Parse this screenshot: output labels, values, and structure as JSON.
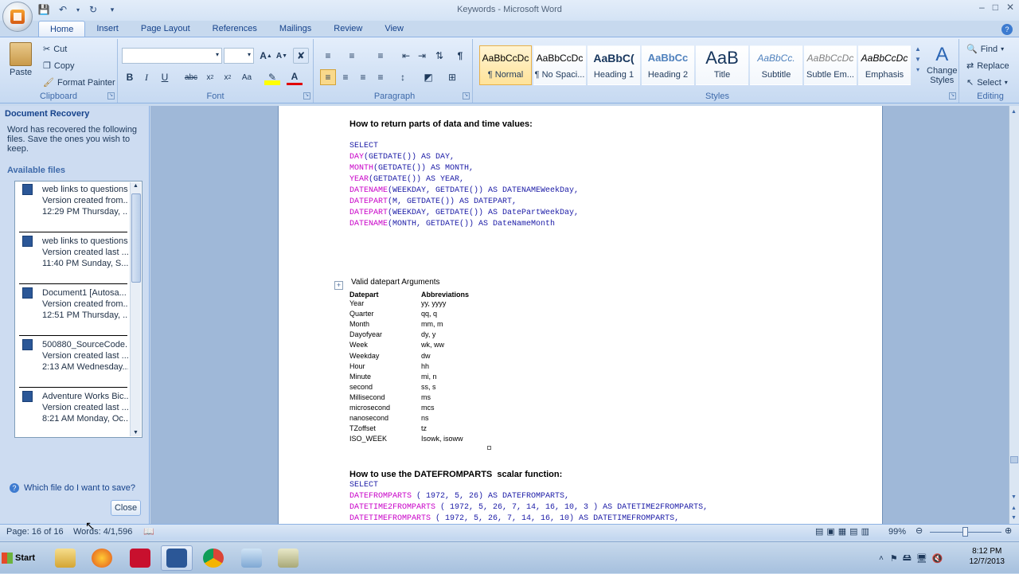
{
  "window": {
    "title": "Keywords - Microsoft Word"
  },
  "tabs": [
    "Home",
    "Insert",
    "Page Layout",
    "References",
    "Mailings",
    "Review",
    "View"
  ],
  "clipboard": {
    "paste": "Paste",
    "cut": "Cut",
    "copy": "Copy",
    "format_painter": "Format Painter",
    "label": "Clipboard"
  },
  "font": {
    "label": "Font"
  },
  "paragraph": {
    "label": "Paragraph"
  },
  "styles": {
    "label": "Styles",
    "items": [
      {
        "preview": "AaBbCcDc",
        "name": "¶ Normal"
      },
      {
        "preview": "AaBbCcDc",
        "name": "¶ No Spaci..."
      },
      {
        "preview": "AaBbC(",
        "name": "Heading 1"
      },
      {
        "preview": "AaBbCc",
        "name": "Heading 2"
      },
      {
        "preview": "AaB",
        "name": "Title"
      },
      {
        "preview": "AaBbCc.",
        "name": "Subtitle"
      },
      {
        "preview": "AaBbCcDc",
        "name": "Subtle Em..."
      },
      {
        "preview": "AaBbCcDc",
        "name": "Emphasis"
      }
    ],
    "change_styles_1": "Change",
    "change_styles_2": "Styles"
  },
  "editing": {
    "find": "Find",
    "replace": "Replace",
    "select": "Select",
    "label": "Editing"
  },
  "recovery": {
    "header": "Document Recovery",
    "message": "Word has recovered the following files.  Save the ones you wish to keep.",
    "available": "Available files",
    "files": [
      {
        "name": "web links to questions ...",
        "desc": "Version created from...",
        "time": "12:29 PM Thursday, ..."
      },
      {
        "name": "web links to questions ...",
        "desc": "Version created last ...",
        "time": "11:40 PM Sunday, S..."
      },
      {
        "name": "Document1  [Autosa...",
        "desc": "Version created from...",
        "time": "12:51 PM Thursday, ..."
      },
      {
        "name": "500880_SourceCode...",
        "desc": "Version created last ...",
        "time": "2:13 AM Wednesday..."
      },
      {
        "name": "Adventure Works Bic...",
        "desc": "Version created last ...",
        "time": "8:21 AM Monday, Oc..."
      }
    ],
    "which_file": "Which file do I want to save?",
    "close": "Close"
  },
  "document": {
    "heading1": "How to return parts of data and time values:",
    "code1": [
      {
        "fn": "",
        "rest": "SELECT"
      },
      {
        "fn": "DAY",
        "rest": "(GETDATE()) AS DAY,"
      },
      {
        "fn": "MONTH",
        "rest": "(GETDATE()) AS MONTH,"
      },
      {
        "fn": "YEAR",
        "rest": "(GETDATE()) AS YEAR,"
      },
      {
        "fn": "DATENAME",
        "rest": "(WEEKDAY, GETDATE()) AS DATENAMEWeekDay,"
      },
      {
        "fn": "DATEPART",
        "rest": "(M, GETDATE()) AS DATEPART,"
      },
      {
        "fn": "DATEPART",
        "rest": "(WEEKDAY, GETDATE()) AS DatePartWeekDay,"
      },
      {
        "fn": "DATENAME",
        "rest": "(MONTH, GETDATE()) AS DateNameMonth"
      }
    ],
    "table_title": "Valid datepart Arguments",
    "table_headers": [
      "Datepart",
      "Abbreviations"
    ],
    "table_rows": [
      [
        "Year",
        "yy, yyyy"
      ],
      [
        "Quarter",
        "qq, q"
      ],
      [
        "Month",
        "mm, m"
      ],
      [
        "Dayofyear",
        "dy, y"
      ],
      [
        "Week",
        "wk, ww"
      ],
      [
        "Weekday",
        "dw"
      ],
      [
        "Hour",
        "hh"
      ],
      [
        "Minute",
        "mi, n"
      ],
      [
        "second",
        "ss, s"
      ],
      [
        "Millisecond",
        "ms"
      ],
      [
        "microsecond",
        "mcs"
      ],
      [
        "nanosecond",
        "ns"
      ],
      [
        "TZoffset",
        "tz"
      ],
      [
        "ISO_WEEK",
        "Isowk, isoww"
      ]
    ],
    "heading2": "How to use the DATEFROMPARTS  scalar function:",
    "code2": [
      {
        "fn": "",
        "rest": "SELECT"
      },
      {
        "fn": "DATEFROMPARTS",
        "rest": " ( 1972, 5, 26) AS DATEFROMPARTS,"
      },
      {
        "fn": "DATETIME2FROMPARTS",
        "rest": " ( 1972, 5, 26, 7, 14, 16, 10, 3 ) AS DATETIME2FROMPARTS,"
      },
      {
        "fn": "DATETIMEFROMPARTS",
        "rest": " ( 1972, 5, 26, 7, 14, 16, 10) AS DATETIMEFROMPARTS,"
      }
    ]
  },
  "status": {
    "page": "Page: 16 of 16",
    "words": "Words: 4/1,596",
    "zoom": "99%"
  },
  "taskbar": {
    "start": "Start",
    "time": "8:12 PM",
    "date": "12/7/2013"
  }
}
